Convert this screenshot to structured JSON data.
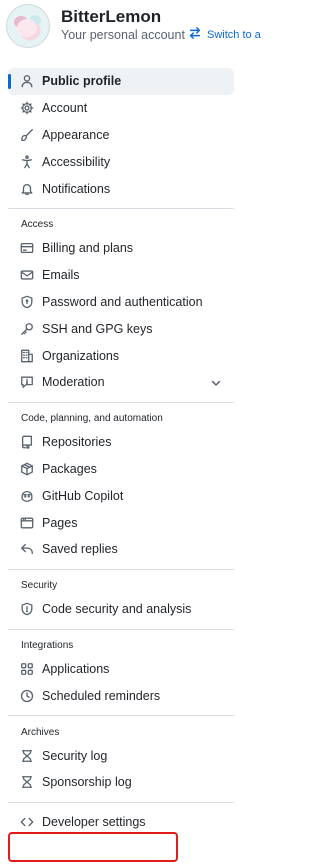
{
  "header": {
    "username": "BitterLemon",
    "account_type": "Your personal account",
    "switch_label": "Switch to a"
  },
  "nav": {
    "top_items": [
      {
        "label": "Public profile",
        "icon": "person-icon",
        "active": true
      },
      {
        "label": "Account",
        "icon": "gear-icon"
      },
      {
        "label": "Appearance",
        "icon": "paintbrush-icon"
      },
      {
        "label": "Accessibility",
        "icon": "accessibility-icon"
      },
      {
        "label": "Notifications",
        "icon": "bell-icon"
      }
    ],
    "groups": [
      {
        "title": "Access",
        "items": [
          {
            "label": "Billing and plans",
            "icon": "credit-card-icon"
          },
          {
            "label": "Emails",
            "icon": "mail-icon"
          },
          {
            "label": "Password and authentication",
            "icon": "shield-lock-icon"
          },
          {
            "label": "SSH and GPG keys",
            "icon": "key-icon"
          },
          {
            "label": "Organizations",
            "icon": "organization-icon"
          },
          {
            "label": "Moderation",
            "icon": "report-icon",
            "expandable": true
          }
        ]
      },
      {
        "title": "Code, planning, and automation",
        "items": [
          {
            "label": "Repositories",
            "icon": "repo-icon"
          },
          {
            "label": "Packages",
            "icon": "package-icon"
          },
          {
            "label": "GitHub Copilot",
            "icon": "copilot-icon"
          },
          {
            "label": "Pages",
            "icon": "browser-icon"
          },
          {
            "label": "Saved replies",
            "icon": "reply-icon"
          }
        ]
      },
      {
        "title": "Security",
        "items": [
          {
            "label": "Code security and analysis",
            "icon": "codescan-icon"
          }
        ]
      },
      {
        "title": "Integrations",
        "items": [
          {
            "label": "Applications",
            "icon": "apps-icon"
          },
          {
            "label": "Scheduled reminders",
            "icon": "clock-icon"
          }
        ]
      },
      {
        "title": "Archives",
        "items": [
          {
            "label": "Security log",
            "icon": "log-icon"
          },
          {
            "label": "Sponsorship log",
            "icon": "log-icon"
          }
        ]
      }
    ],
    "bottom_item": {
      "label": "Developer settings",
      "icon": "code-icon"
    }
  },
  "colors": {
    "accent": "#0969da",
    "highlight_border": "#e31b1b",
    "active_bg": "#eff2f5",
    "divider": "#d8dee4"
  }
}
